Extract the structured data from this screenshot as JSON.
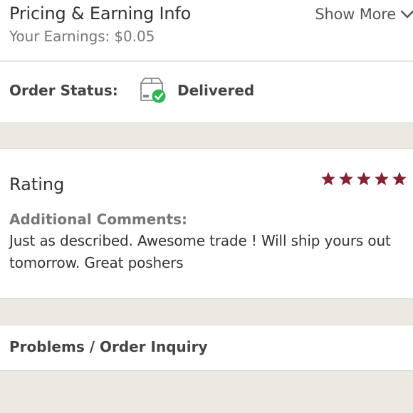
{
  "pricing": {
    "title": "Pricing & Earning Info",
    "earnings_label": "Your Earnings: $0.05",
    "show_more_label": "Show More",
    "chevron_icon": "chevron-down-icon"
  },
  "order_status": {
    "label": "Order Status:",
    "icon": "delivered-box-icon",
    "value": "Delivered",
    "colors": {
      "check": "#2fb457"
    }
  },
  "rating": {
    "heading": "Rating",
    "stars": 5,
    "max_stars": 5,
    "star_color": "#822433",
    "comments_heading": "Additional Comments:",
    "comments_text": "Just as described. Awesome trade ! Will ship yours out tomorrow. Great poshers"
  },
  "inquiry": {
    "label": "Problems / Order Inquiry"
  }
}
